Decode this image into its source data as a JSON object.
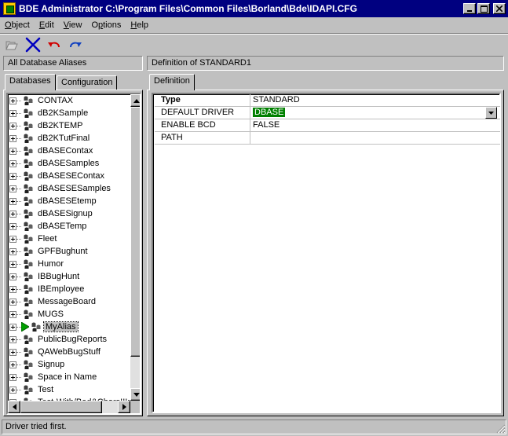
{
  "window": {
    "title": "BDE Administrator  C:\\Program Files\\Common Files\\Borland\\Bde\\IDAPI.CFG"
  },
  "menu": [
    {
      "label": "Object",
      "underline": "O",
      "rest": "bject"
    },
    {
      "label": "Edit",
      "underline": "E",
      "rest": "dit"
    },
    {
      "label": "View",
      "underline": "V",
      "rest": "iew"
    },
    {
      "label": "Options",
      "underline": "p",
      "pre": "O",
      "rest": "tions"
    },
    {
      "label": "Help",
      "underline": "H",
      "rest": "elp"
    }
  ],
  "toolbar": {
    "icons": [
      "open-folder-icon",
      "delete-icon",
      "undo-icon",
      "redo-icon"
    ]
  },
  "left": {
    "header": "All Database Aliases",
    "tabs": [
      "Databases",
      "Configuration"
    ],
    "aliases": [
      "CONTAX",
      "dB2KSample",
      "dB2KTEMP",
      "dB2KTutFinal",
      "dBASEContax",
      "dBASESamples",
      "dBASESEContax",
      "dBASESESamples",
      "dBASESEtemp",
      "dBASESignup",
      "dBASETemp",
      "Fleet",
      "GPFBughunt",
      "Humor",
      "IBBugHunt",
      "IBEmployee",
      "MessageBoard",
      "MUGS",
      "MyAlias",
      "PublicBugReports",
      "QAWebBugStuff",
      "Signup",
      "Space in Name",
      "Test",
      "Test-With/Bad&CharsIIIn"
    ],
    "selected_alias": "MyAlias"
  },
  "right": {
    "header": "Definition of STANDARD1",
    "tab": "Definition",
    "rows": [
      {
        "key": "Type",
        "value": "STANDARD"
      },
      {
        "key": "DEFAULT DRIVER",
        "value": "DBASE"
      },
      {
        "key": "ENABLE BCD",
        "value": "FALSE"
      },
      {
        "key": "PATH",
        "value": ""
      }
    ]
  },
  "status": {
    "text": "Driver tried first."
  },
  "colors": {
    "title_bar": "#000080",
    "face": "#c0c0c0",
    "selected_value": "#008000"
  }
}
